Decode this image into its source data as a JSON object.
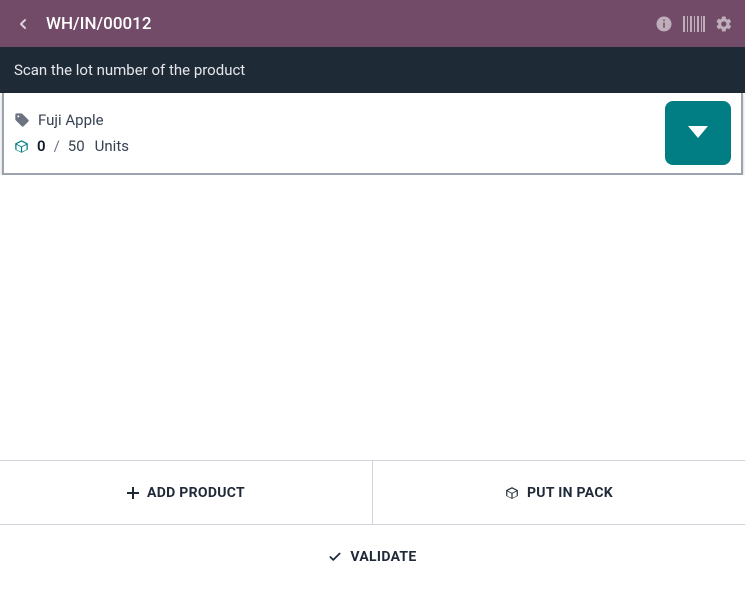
{
  "header": {
    "title": "WH/IN/00012"
  },
  "subheader": {
    "text": "Scan the lot number of the product"
  },
  "product": {
    "name": "Fuji Apple",
    "qty_done": "0",
    "slash": "/",
    "qty_demand": "50",
    "uom": "Units"
  },
  "actions": {
    "add_product": "ADD PRODUCT",
    "put_in_pack": "PUT IN PACK",
    "validate": "VALIDATE"
  }
}
